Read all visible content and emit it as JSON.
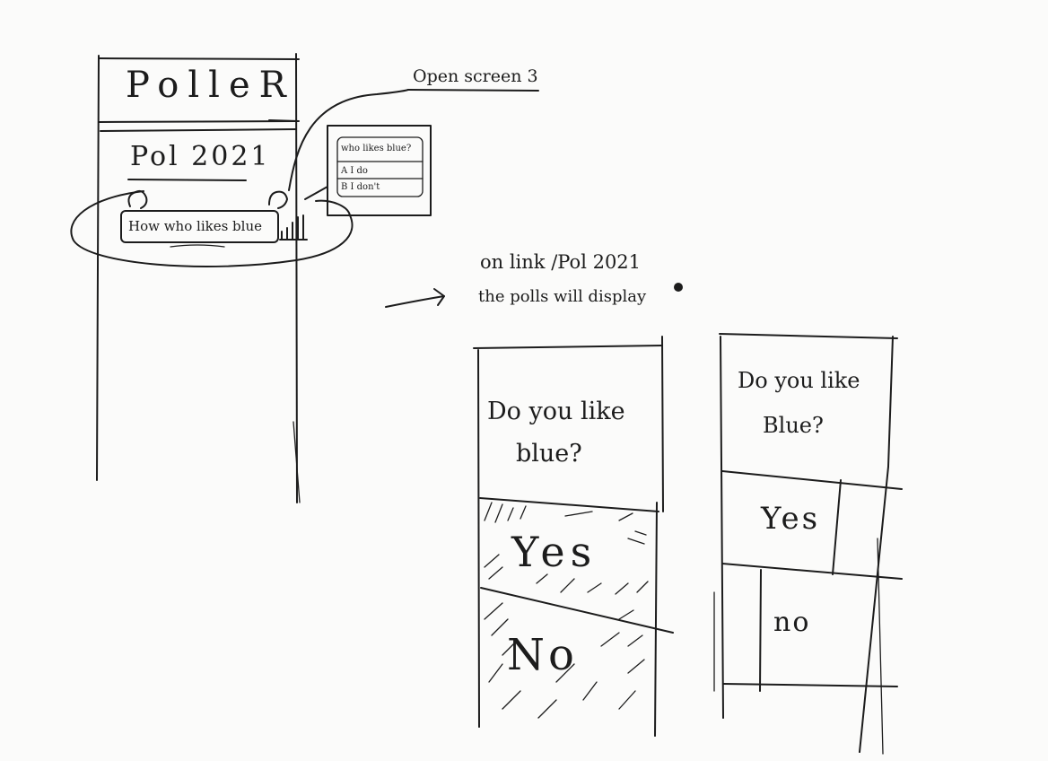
{
  "screen1": {
    "app_title": "PolleR",
    "poll_name": "Pol 2021",
    "poll_item_text": "How who likes blue"
  },
  "mini_preview": {
    "question": "who likes blue?",
    "option_a": "A I do",
    "option_b": "B I don't"
  },
  "annotations": {
    "open_screen": "Open screen 3",
    "link_line1": "on link /Pol 2021",
    "link_line2": "the polls will display"
  },
  "screen_results": {
    "question_line1": "Do you like",
    "question_line2": "blue?",
    "option_yes": "Yes",
    "option_no": "No"
  },
  "screen_vote": {
    "question_line1": "Do you like",
    "question_line2": "Blue?",
    "option_yes": "Yes",
    "option_no": "no"
  }
}
